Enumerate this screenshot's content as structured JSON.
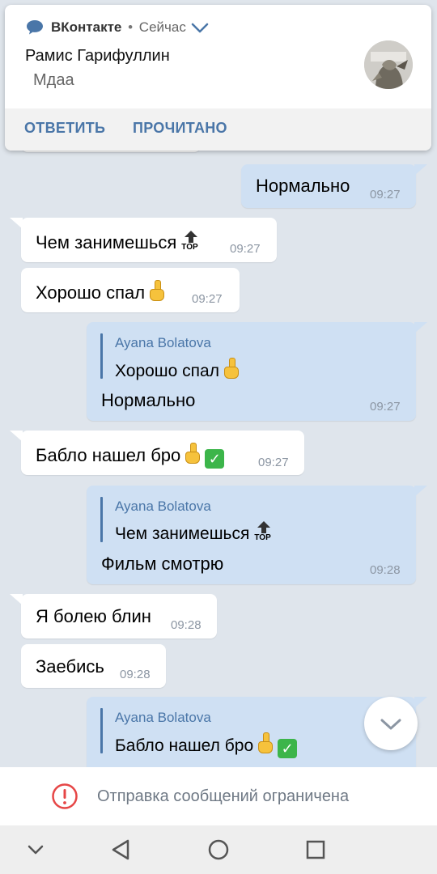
{
  "notification": {
    "app_name": "ВКонтакте",
    "separator": "•",
    "time": "Сейчас",
    "sender": "Рамис Гарифуллин",
    "message": "Мдаа",
    "avatar_icon": "avatar-image",
    "actions": {
      "reply": "ОТВЕТИТЬ",
      "read": "ПРОЧИТАНО"
    }
  },
  "messages": [
    {
      "dir": "out",
      "text": "Нормально",
      "time": "09:27"
    },
    {
      "dir": "in",
      "text": "Чем занимешься",
      "emoji": "top-arrow",
      "time": "09:27"
    },
    {
      "dir": "in",
      "text": "Хорошо спал",
      "emoji": "index-finger",
      "time": "09:27"
    },
    {
      "dir": "out",
      "reply_name": "Ayana Bolatova",
      "reply_text": "Хорошо спал",
      "text": "Нормально",
      "time": "09:27"
    },
    {
      "dir": "in",
      "text": "Бабло нашел бро",
      "emoji": "index-finger-check",
      "time": "09:27"
    },
    {
      "dir": "out",
      "reply_name": "Ayana Bolatova",
      "reply_text": "Чем занимешься",
      "text": "Фильм смотрю",
      "time": "09:28"
    },
    {
      "dir": "in",
      "text": "Я болею блин",
      "time": "09:28"
    },
    {
      "dir": "in",
      "text": "Заебись",
      "time": "09:28"
    },
    {
      "dir": "out",
      "reply_name": "Ayana Bolatova",
      "reply_text": "Бабло нашел бро"
    }
  ],
  "top_emoji_label": "TOP",
  "restriction": {
    "text": "Отправка сообщений ограничена",
    "icon": "alert-circle-icon",
    "icon_color": "#e64646"
  },
  "colors": {
    "accent": "#4a76a8",
    "incoming_bubble": "#ffffff",
    "outgoing_bubble": "#cfe0f3",
    "background": "#dfe5ec"
  },
  "nav": {
    "icons": [
      "chevron-down-icon",
      "back-triangle-icon",
      "home-circle-icon",
      "recents-square-icon"
    ]
  }
}
